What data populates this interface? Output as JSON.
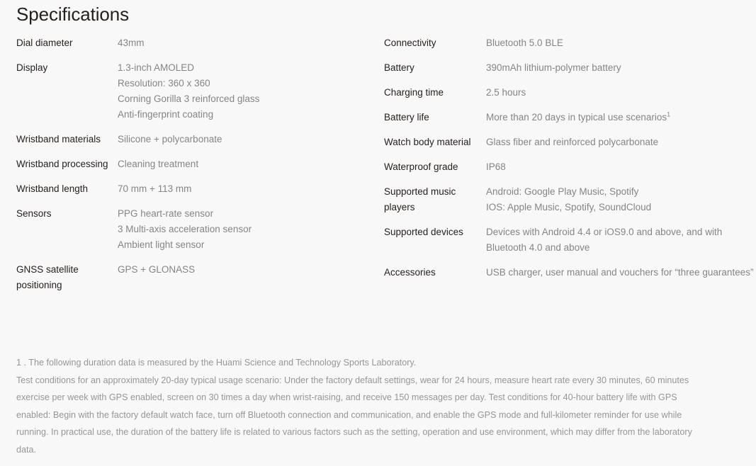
{
  "heading": "Specifications",
  "colors": {
    "background": "#f8f8f8",
    "heading_text": "#26211f",
    "label_text": "#26211f",
    "value_text": "#858585",
    "footnote_text": "#969696"
  },
  "left_column": [
    {
      "label": "Dial diameter",
      "values": [
        "43mm"
      ]
    },
    {
      "label": "Display",
      "values": [
        "1.3-inch AMOLED",
        "Resolution: 360 x 360",
        "Corning Gorilla 3 reinforced glass",
        "Anti-fingerprint coating"
      ]
    },
    {
      "label": "Wristband materials",
      "values": [
        "Silicone + polycarbonate"
      ]
    },
    {
      "label": "Wristband processing",
      "values": [
        "Cleaning treatment"
      ]
    },
    {
      "label": "Wristband length",
      "values": [
        "70 mm + 113 mm"
      ]
    },
    {
      "label": "Sensors",
      "values": [
        "PPG heart-rate sensor",
        "3 Multi-axis acceleration sensor",
        "Ambient light sensor"
      ]
    },
    {
      "label": "GNSS satellite positioning",
      "values": [
        "GPS + GLONASS"
      ]
    }
  ],
  "right_column": [
    {
      "label": "Connectivity",
      "values": [
        "Bluetooth 5.0 BLE"
      ]
    },
    {
      "label": "Battery",
      "values": [
        "390mAh lithium-polymer battery"
      ]
    },
    {
      "label": "Charging time",
      "values": [
        "2.5 hours"
      ]
    },
    {
      "label": "Battery life",
      "values": [
        "More than 20 days in typical use scenarios"
      ],
      "footnote_marker": "1"
    },
    {
      "label": "Watch body material",
      "values": [
        "Glass fiber and reinforced polycarbonate"
      ]
    },
    {
      "label": "Waterproof grade",
      "values": [
        "IP68"
      ]
    },
    {
      "label": "Supported music players",
      "values": [
        "Android: Google Play Music, Spotify",
        "IOS: Apple Music, Spotify, SoundCloud"
      ]
    },
    {
      "label": "Supported devices",
      "values": [
        "Devices with Android 4.4 or iOS9.0 and above, and with",
        "Bluetooth 4.0 and above"
      ]
    },
    {
      "label": "Accessories",
      "values": [
        "USB charger, user manual and vouchers for “three guarantees”"
      ]
    }
  ],
  "footnotes": {
    "lines": [
      "1 . The following duration data is measured by the Huami Science and Technology Sports Laboratory.",
      "Test conditions for an approximately 20-day typical usage scenario: Under the factory default settings, wear for 24 hours, measure heart rate every 30 minutes, 60 minutes",
      "exercise per week with GPS enabled, screen on 30 times a day when wrist-raising, and receive 150 messages per day. Test conditions for 40-hour battery life with GPS",
      "enabled: Begin with the factory default watch face, turn off Bluetooth connection and communication, and enable the GPS mode and full-kilometer reminder for use while",
      "running. In practical use, the duration of the battery life is related to various factors such as the setting, operation and use environment, which may differ from the laboratory",
      "data."
    ]
  }
}
